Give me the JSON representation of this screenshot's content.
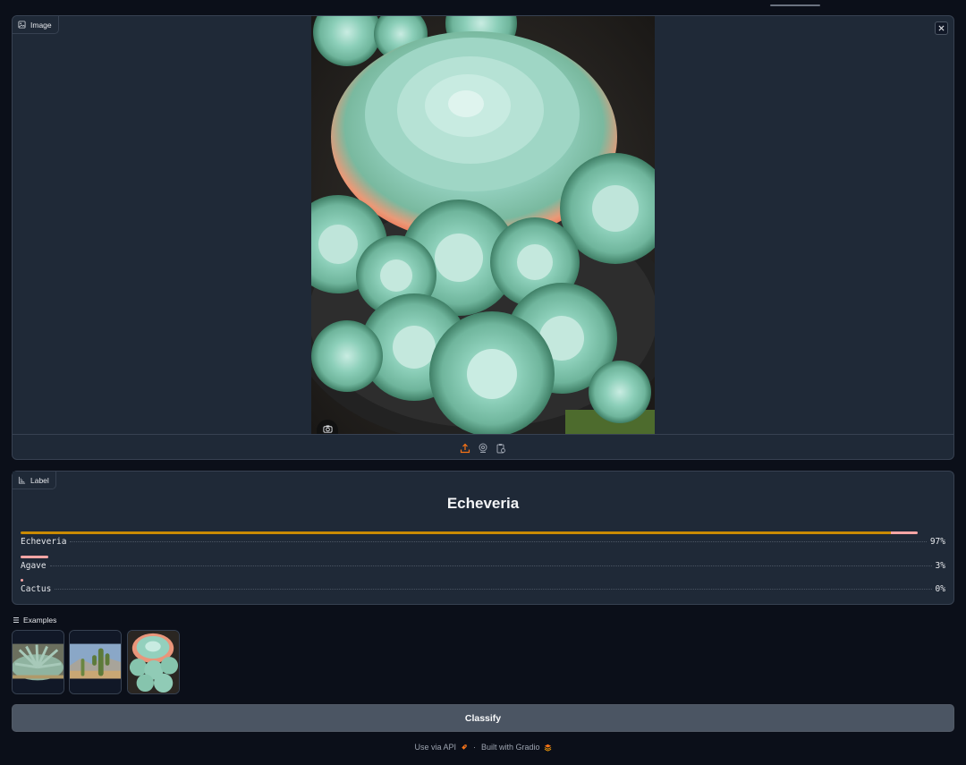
{
  "image_panel": {
    "label": "Image",
    "icon": "image-icon",
    "close_icon": "close-icon",
    "sources": [
      "upload-icon",
      "webcam-icon",
      "clipboard-icon"
    ],
    "active_source": "upload-icon",
    "accent_color": "#f97316"
  },
  "label_panel": {
    "label": "Label",
    "icon": "label-chart-icon",
    "predicted": "Echeveria",
    "confidences": [
      {
        "label": "Echeveria",
        "percent_text": "97%",
        "value": 0.97
      },
      {
        "label": "Agave",
        "percent_text": "3%",
        "value": 0.03
      },
      {
        "label": "Cactus",
        "percent_text": "0%",
        "value": 0.0
      }
    ],
    "bar_colors": [
      "#ca8a04",
      "#fca5a5"
    ]
  },
  "examples": {
    "label": "Examples",
    "icon": "list-icon",
    "items": [
      "agave-thumbnail",
      "cactus-thumbnail",
      "echeveria-thumbnail"
    ]
  },
  "classify_label": "Classify",
  "footer": {
    "api_text": "Use via API",
    "separator": "·",
    "built_text": "Built with Gradio"
  },
  "colors": {
    "background": "#0b0f19",
    "panel": "#1f2937",
    "button": "#4b5563"
  }
}
